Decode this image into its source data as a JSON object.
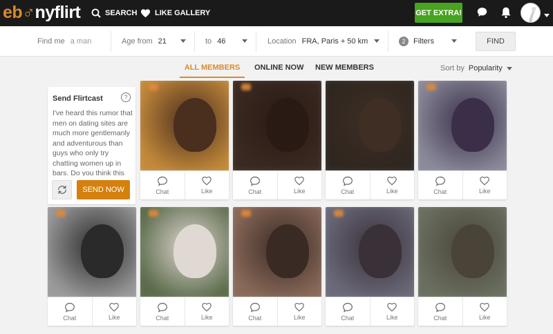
{
  "brand": {
    "logo_part1": "eb",
    "logo_glyph": "♂",
    "logo_part2": "nyflirt"
  },
  "nav": {
    "search_label": "SEARCH",
    "gallery_label": "LIKE GALLERY",
    "extra_label": "GET EXTRA!"
  },
  "search": {
    "findme_label": "Find me",
    "findme_value": "a man",
    "age_from_label": "Age from",
    "age_from_value": "21",
    "age_to_label": "to",
    "age_to_value": "46",
    "location_label": "Location",
    "location_value": "FRA, Paris + 50 km",
    "filters_count": "2",
    "filters_label": "Filters",
    "find_label": "FIND"
  },
  "tabs": [
    "ALL MEMBERS",
    "ONLINE NOW",
    "NEW MEMBERS"
  ],
  "sort": {
    "label": "Sort by",
    "value": "Popularity"
  },
  "flirtcast": {
    "title": "Send Flirtcast",
    "help": "?",
    "message": "I've heard this rumor that men on dating sites are much more gentlemanly and adventurous than guys who only try chatting women up in bars. Do you think this",
    "send_label": "SEND NOW"
  },
  "card_actions": {
    "chat": "Chat",
    "like": "Like"
  },
  "members": [
    {
      "bg": "#c48a3a",
      "face": "#4a2e1e"
    },
    {
      "bg": "#3a2a22",
      "face": "#2a1a14"
    },
    {
      "bg": "#2e2620",
      "face": "#3e2e24"
    },
    {
      "bg": "#8a8a9a",
      "face": "#3a2e48"
    },
    {
      "bg": "#9a9a9a",
      "face": "#2a2a2a"
    },
    {
      "bg": "#5a6a4a",
      "face": "#e0d8d2"
    },
    {
      "bg": "#8a6a5a",
      "face": "#3a2a24"
    },
    {
      "bg": "#6a6a7a",
      "face": "#3a3038"
    },
    {
      "bg": "#6a7060",
      "face": "#4a4438"
    }
  ],
  "colors": {
    "accent": "#d98a2b",
    "extra_button": "#48a321",
    "send_button": "#d4810e"
  }
}
